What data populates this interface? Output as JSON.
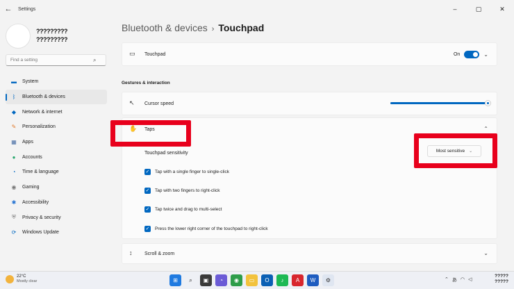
{
  "window": {
    "title": "Settings",
    "back_glyph": "←",
    "minimize_glyph": "–",
    "maximize_glyph": "▢",
    "close_glyph": "✕"
  },
  "profile": {
    "name_line1": "?????????",
    "name_line2": "?????????"
  },
  "search": {
    "placeholder": "Find a setting",
    "icon": "search-icon"
  },
  "sidebar": {
    "items": [
      {
        "label": "System",
        "icon": "system-icon",
        "color": "#0067c0"
      },
      {
        "label": "Bluetooth & devices",
        "icon": "bluetooth-icon",
        "color": "#0067c0",
        "active": true
      },
      {
        "label": "Network & internet",
        "icon": "wifi-icon",
        "color": "#0067c0"
      },
      {
        "label": "Personalization",
        "icon": "brush-icon",
        "color": "#e07a2c"
      },
      {
        "label": "Apps",
        "icon": "apps-icon",
        "color": "#4a6fa5"
      },
      {
        "label": "Accounts",
        "icon": "accounts-icon",
        "color": "#2aa76e"
      },
      {
        "label": "Time & language",
        "icon": "clock-icon",
        "color": "#0067c0"
      },
      {
        "label": "Gaming",
        "icon": "gaming-icon",
        "color": "#777777"
      },
      {
        "label": "Accessibility",
        "icon": "accessibility-icon",
        "color": "#1f6fd1"
      },
      {
        "label": "Privacy & security",
        "icon": "shield-icon",
        "color": "#777777"
      },
      {
        "label": "Windows Update",
        "icon": "update-icon",
        "color": "#0067c0"
      }
    ]
  },
  "breadcrumb": {
    "parent": "Bluetooth & devices",
    "separator": "›",
    "current": "Touchpad"
  },
  "touchpad_row": {
    "label": "Touchpad",
    "state": "On"
  },
  "section_heading": "Gestures & interaction",
  "cursor_speed": {
    "label": "Cursor speed",
    "value_fraction": 0.99
  },
  "taps": {
    "label": "Taps",
    "sensitivity_label": "Touchpad sensitivity",
    "sensitivity_value": "Most sensitive",
    "options": [
      {
        "label": "Tap with a single finger to single-click",
        "checked": true
      },
      {
        "label": "Tap with two fingers to right-click",
        "checked": true
      },
      {
        "label": "Tap twice and drag to multi-select",
        "checked": true
      },
      {
        "label": "Press the lower right corner of the touchpad to right-click",
        "checked": true
      }
    ]
  },
  "scroll_zoom": {
    "label": "Scroll & zoom"
  },
  "taskbar": {
    "weather_temp": "22°C",
    "weather_condition": "Mostly clear",
    "clock_line1": "?????",
    "clock_line2": "?????"
  },
  "colors": {
    "accent": "#0067c0",
    "highlight": "#e8001c"
  }
}
